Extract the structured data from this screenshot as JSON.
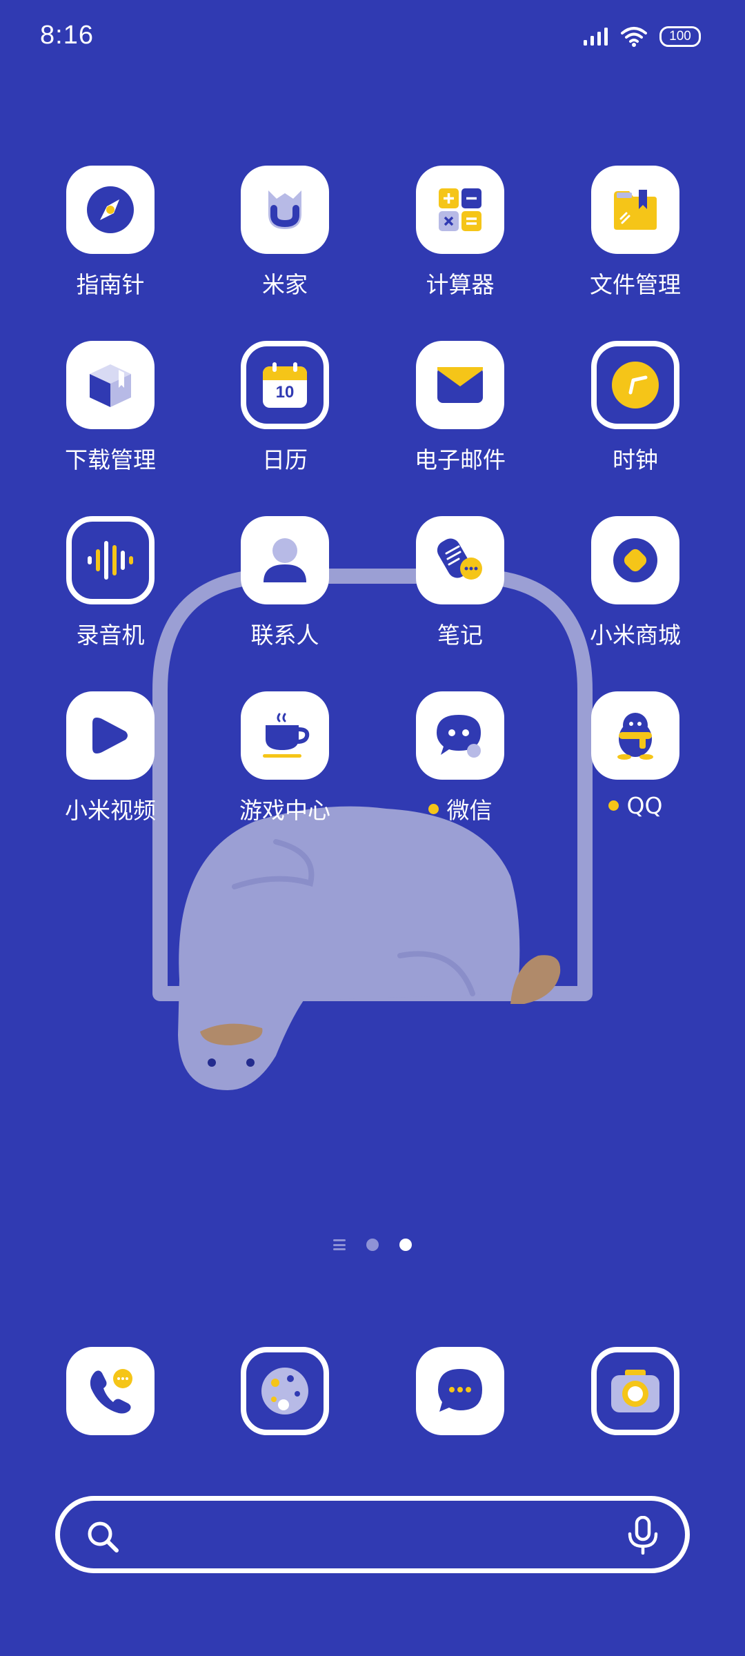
{
  "status_bar": {
    "time": "8:16",
    "battery": "100",
    "icons": [
      "signal-icon",
      "wifi-icon",
      "battery-icon"
    ]
  },
  "apps": [
    {
      "label": "指南针",
      "icon": "compass-icon"
    },
    {
      "label": "米家",
      "icon": "mijia-icon"
    },
    {
      "label": "计算器",
      "icon": "calculator-icon"
    },
    {
      "label": "文件管理",
      "icon": "file-manager-icon"
    },
    {
      "label": "下载管理",
      "icon": "download-manager-icon"
    },
    {
      "label": "日历",
      "icon": "calendar-icon",
      "calendar_day": "10"
    },
    {
      "label": "电子邮件",
      "icon": "email-icon"
    },
    {
      "label": "时钟",
      "icon": "clock-icon"
    },
    {
      "label": "录音机",
      "icon": "recorder-icon"
    },
    {
      "label": "联系人",
      "icon": "contacts-icon"
    },
    {
      "label": "笔记",
      "icon": "notes-icon"
    },
    {
      "label": "小米商城",
      "icon": "mi-store-icon"
    },
    {
      "label": "小米视频",
      "icon": "mi-video-icon"
    },
    {
      "label": "游戏中心",
      "icon": "game-center-icon"
    },
    {
      "label": "微信",
      "icon": "wechat-icon",
      "notification": true
    },
    {
      "label": "QQ",
      "icon": "qq-icon",
      "notification": true
    }
  ],
  "dock": [
    {
      "icon": "phone-icon"
    },
    {
      "icon": "browser-icon"
    },
    {
      "icon": "messages-icon"
    },
    {
      "icon": "camera-icon"
    }
  ],
  "page_indicator": {
    "pages": 2,
    "active": 2
  },
  "search_bar": {
    "icons": [
      "search-icon",
      "microphone-icon"
    ]
  },
  "colors": {
    "background": "#303AB2",
    "accent": "#F5C518",
    "tile": "#FFFFFF",
    "wallpaper_shape": "#9B9FD4"
  }
}
